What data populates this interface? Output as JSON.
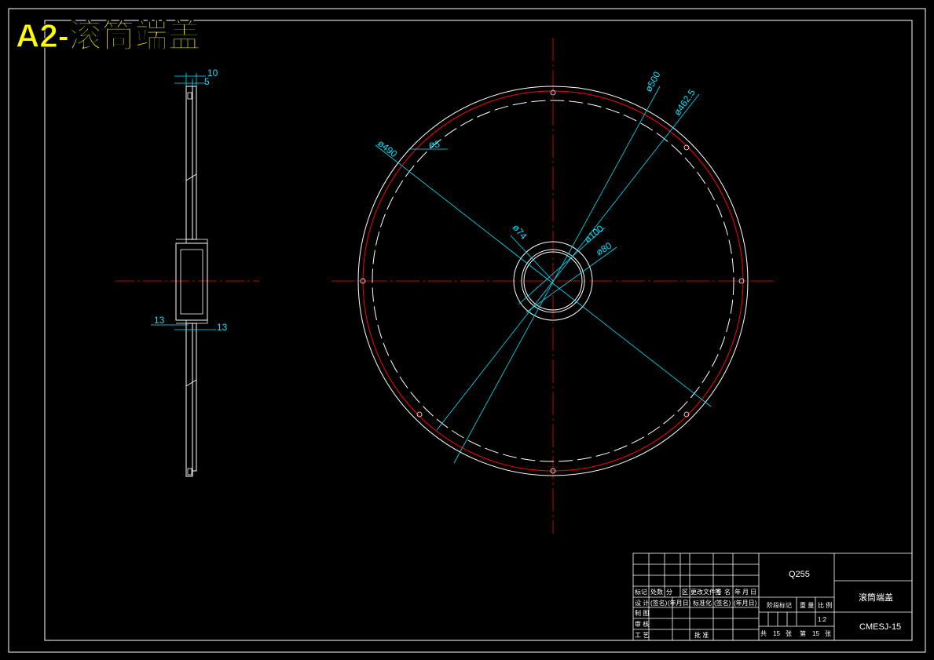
{
  "sheet_title": "A2-滚筒端盖",
  "side_view": {
    "dims": {
      "d10": "10",
      "d5": "5",
      "d13_left": "13",
      "d13_right": "13"
    }
  },
  "front_view": {
    "dims": {
      "phi500": "ø500",
      "phi462_5": "ø462.5",
      "phi490": "ø490",
      "phi5": "ø5",
      "phi74": "ø74",
      "phi100": "ø100",
      "phi80": "ø80"
    }
  },
  "title_block": {
    "material": "Q255",
    "part_name": "滚筒端盖",
    "drawing_no": "CMESJ-15",
    "scale": "1:2",
    "header_cols": [
      "标记",
      "处数",
      "分",
      "区",
      "更改文件号",
      "签",
      "名",
      "年",
      "月",
      "日"
    ],
    "row_design": [
      "设 计",
      "(签名)",
      "(年月日)",
      "标准化",
      "(签名)",
      "(年月日)"
    ],
    "row_draw": "制 图",
    "row_check": "审 核",
    "row_process": "工 艺",
    "approve": "批 准",
    "stage_mark": "阶段标记",
    "weight": "重 量",
    "ratio": "比 例",
    "sheets_total_label": "共",
    "sheets_total": "15",
    "sheets_unit": "张",
    "sheet_no_label": "第",
    "sheet_no": "15",
    "sheet_no_unit": "张"
  },
  "colors": {
    "line": "#ffffff",
    "center": "#ff0000",
    "dimension": "#00e5ff",
    "title": "#ffff00",
    "background": "#000000"
  }
}
